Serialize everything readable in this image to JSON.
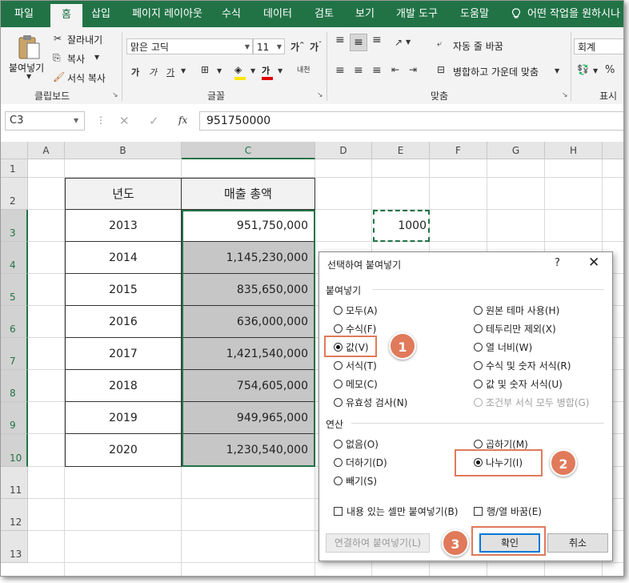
{
  "ribbon": {
    "tabs": [
      "파일",
      "홈",
      "삽입",
      "페이지 레이아웃",
      "수식",
      "데이터",
      "검토",
      "보기",
      "개발 도구",
      "도움말",
      "어떤 작업을 원하시나"
    ],
    "clipboard": {
      "paste": "붙여넣기",
      "cut": "잘라내기",
      "copy": "복사",
      "format_painter": "서식 복사",
      "label": "클립보드"
    },
    "font": {
      "name": "맑은 고딕",
      "size": "11",
      "bold": "가",
      "italic": "가",
      "underline": "가",
      "label": "글꼴"
    },
    "alignment": {
      "wrap_text": "자동 줄 바꿈",
      "merge_center": "병합하고 가운데 맞춤",
      "label": "맞춤"
    },
    "number": {
      "format": "회계",
      "percent": "%",
      "label": "표시"
    }
  },
  "formula_bar": {
    "name_box": "C3",
    "fx": "fx",
    "value": "951750000"
  },
  "sheet": {
    "columns": [
      "A",
      "B",
      "C",
      "D",
      "E",
      "F",
      "G",
      "H"
    ],
    "rows": [
      "1",
      "2",
      "3",
      "4",
      "5",
      "6",
      "7",
      "8",
      "9",
      "10",
      "11",
      "12",
      "13"
    ],
    "header_year": "년도",
    "header_sales": "매출 총액",
    "data": [
      {
        "year": "2013",
        "sales": "951,750,000"
      },
      {
        "year": "2014",
        "sales": "1,145,230,000"
      },
      {
        "year": "2015",
        "sales": "835,650,000"
      },
      {
        "year": "2016",
        "sales": "636,000,000"
      },
      {
        "year": "2017",
        "sales": "1,421,540,000"
      },
      {
        "year": "2018",
        "sales": "754,605,000"
      },
      {
        "year": "2019",
        "sales": "949,965,000"
      },
      {
        "year": "2020",
        "sales": "1,230,540,000"
      }
    ],
    "e3": "1000"
  },
  "dialog": {
    "title": "선택하여 붙여넣기",
    "help": "?",
    "close": "✕",
    "paste_section": "붙여넣기",
    "paste_left": [
      "모두(A)",
      "수식(F)",
      "값(V)",
      "서식(T)",
      "메모(C)",
      "유효성 검사(N)"
    ],
    "paste_right": [
      "원본 테마 사용(H)",
      "테두리만 제외(X)",
      "열 너비(W)",
      "수식 및 숫자 서식(R)",
      "값 및 숫자 서식(U)",
      "조건부 서식 모두 병합(G)"
    ],
    "op_section": "연산",
    "op_left": [
      "없음(O)",
      "더하기(D)",
      "빼기(S)"
    ],
    "op_right": [
      "곱하기(M)",
      "나누기(I)"
    ],
    "skip_blanks": "내용 있는 셀만 붙여넣기(B)",
    "transpose": "행/열 바꿈(E)",
    "paste_link": "연결하여 붙여넣기(L)",
    "ok": "확인",
    "cancel": "취소"
  },
  "annotations": {
    "step1": "1",
    "step2": "2",
    "step3": "3",
    "accent": "#e07a5a"
  }
}
